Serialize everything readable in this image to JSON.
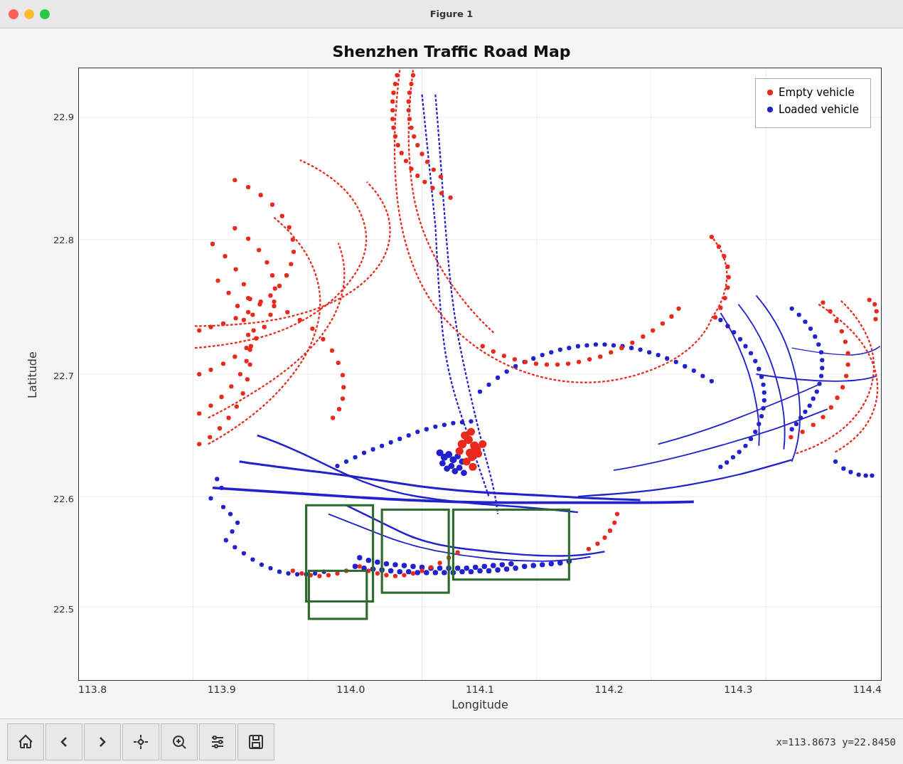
{
  "window": {
    "title": "Figure 1"
  },
  "chart": {
    "title": "Shenzhen Traffic Road Map",
    "x_label": "Longitude",
    "y_label": "Latitude",
    "x_ticks": [
      "113.8",
      "113.9",
      "114.0",
      "114.1",
      "114.2",
      "114.3",
      "114.4"
    ],
    "y_ticks": [
      "22.9",
      "22.8",
      "22.7",
      "22.6",
      "22.5"
    ],
    "legend": {
      "empty_label": "Empty vehicle",
      "loaded_label": "Loaded vehicle",
      "empty_color": "#e8291c",
      "loaded_color": "#2222cc"
    }
  },
  "toolbar": {
    "buttons": [
      "home",
      "back",
      "forward",
      "move",
      "zoom",
      "config",
      "save"
    ]
  },
  "status": {
    "coords": "x=113.8673 y=22.8450"
  }
}
